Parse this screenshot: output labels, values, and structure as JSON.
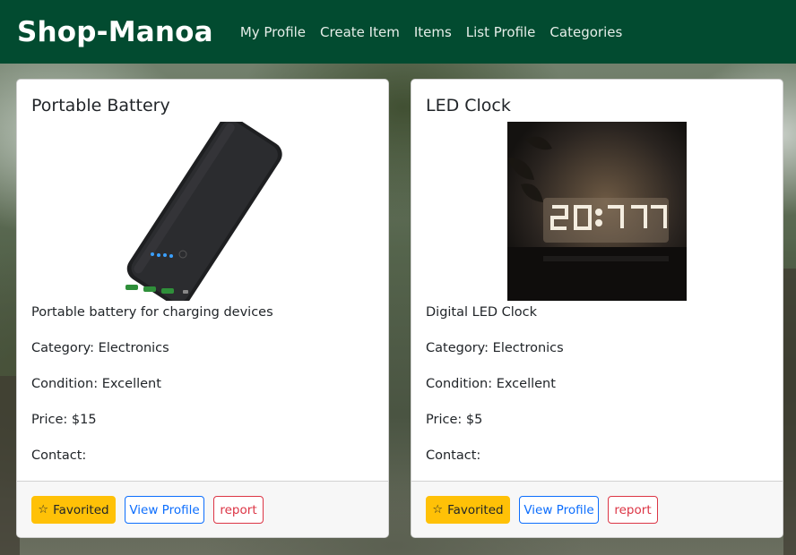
{
  "navbar": {
    "brand": "Shop-Manoa",
    "links": [
      "My Profile",
      "Create Item",
      "Items",
      "List Profile",
      "Categories"
    ],
    "bg_color": "#024b30"
  },
  "items": [
    {
      "title": "Portable Battery",
      "image": "portable-battery-image",
      "description": "Portable battery for charging devices",
      "category": "Category: Electronics",
      "condition": "Condition: Excellent",
      "price": "Price: $15",
      "contact": "Contact:",
      "favorited_label": "Favorited",
      "view_profile_label": "View Profile",
      "report_label": "report"
    },
    {
      "title": "LED Clock",
      "image": "led-clock-image",
      "description": "Digital LED Clock",
      "category": "Category: Electronics",
      "condition": "Condition: Excellent",
      "price": "Price: $5",
      "contact": "Contact:",
      "favorited_label": "Favorited",
      "view_profile_label": "View Profile",
      "report_label": "report"
    }
  ],
  "colors": {
    "favorited": "#ffc107",
    "view_profile": "#0d6efd",
    "report": "#dc3545"
  }
}
